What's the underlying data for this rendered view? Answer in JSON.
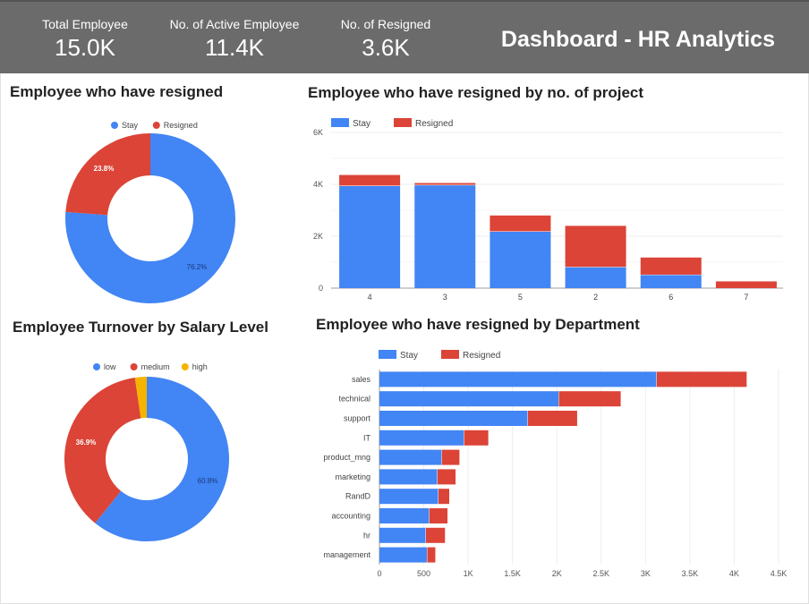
{
  "kpis": [
    {
      "label": "Total Employee",
      "value": "15.0K"
    },
    {
      "label": "No. of Active Employee",
      "value": "11.4K"
    },
    {
      "label": "No. of Resigned",
      "value": "3.6K"
    }
  ],
  "dashboard_title": "Dashboard - HR Analytics",
  "colors": {
    "stay": "#4285f4",
    "resigned": "#db4437",
    "high": "#f4b400",
    "header": "#6b6b6b"
  },
  "chart_data": [
    {
      "id": "resigned_pie",
      "type": "pie",
      "title": "Employee who have resigned",
      "legend": [
        "Stay",
        "Resigned"
      ],
      "values": [
        76.2,
        23.8
      ],
      "labels": [
        "76.2%",
        "23.8%"
      ],
      "colors": [
        "#4285f4",
        "#db4437"
      ]
    },
    {
      "id": "project_bar",
      "type": "bar",
      "title": "Employee who have resigned by no. of project",
      "legend": [
        "Stay",
        "Resigned"
      ],
      "categories": [
        "4",
        "3",
        "5",
        "2",
        "6",
        "7"
      ],
      "series": [
        {
          "name": "Stay",
          "values": [
            3950,
            3980,
            2190,
            820,
            520,
            0
          ]
        },
        {
          "name": "Resigned",
          "values": [
            410,
            70,
            610,
            1580,
            660,
            260
          ]
        }
      ],
      "ylim": [
        0,
        6000
      ],
      "yticks": [
        "0",
        "2K",
        "4K",
        "6K"
      ],
      "grid": true,
      "legend_position": "top-left"
    },
    {
      "id": "salary_pie",
      "type": "pie",
      "title": "Employee Turnover by Salary Level",
      "legend": [
        "low",
        "medium",
        "high"
      ],
      "values": [
        60.8,
        36.9,
        2.3
      ],
      "labels": [
        "60.8%",
        "36.9%",
        ""
      ],
      "colors": [
        "#4285f4",
        "#db4437",
        "#f4b400"
      ]
    },
    {
      "id": "department_bar",
      "type": "bar",
      "orientation": "horizontal",
      "title": "Employee who have resigned by Department",
      "legend": [
        "Stay",
        "Resigned"
      ],
      "categories": [
        "sales",
        "technical",
        "support",
        "IT",
        "product_mng",
        "marketing",
        "RandD",
        "accounting",
        "hr",
        "management"
      ],
      "series": [
        {
          "name": "Stay",
          "values": [
            3126,
            2023,
            1674,
            954,
            704,
            655,
            666,
            563,
            524,
            539
          ]
        },
        {
          "name": "Resigned",
          "values": [
            1014,
            697,
            555,
            273,
            198,
            203,
            121,
            204,
            215,
            91
          ]
        }
      ],
      "xlim": [
        0,
        4500
      ],
      "xticks": [
        "0",
        "500",
        "1K",
        "1.5K",
        "2K",
        "2.5K",
        "3K",
        "3.5K",
        "4K",
        "4.5K"
      ],
      "grid": true,
      "legend_position": "top-left"
    }
  ]
}
